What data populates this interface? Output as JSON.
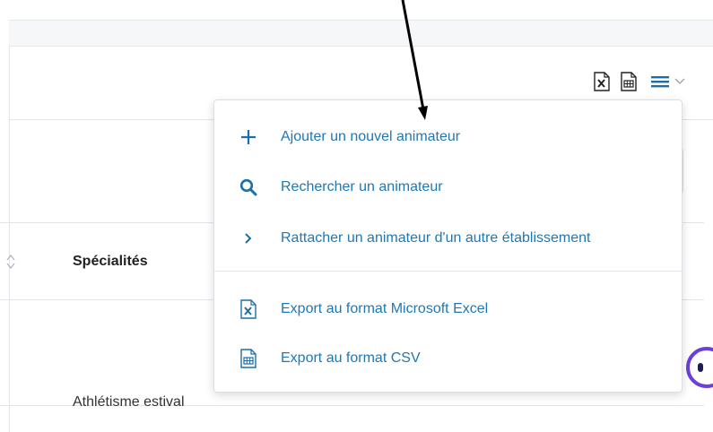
{
  "toolbar": {
    "export_excel_icon": "excel-file-icon",
    "export_csv_icon": "csv-file-icon",
    "menu_icon": "hamburger-menu-icon",
    "menu_caret_icon": "chevron-down-icon"
  },
  "table": {
    "columns": [
      {
        "label": "Spécialités"
      }
    ],
    "rows": [
      {
        "specialites": "Athlétisme estival"
      }
    ]
  },
  "dropdown": {
    "items": [
      {
        "icon": "plus-icon",
        "label": "Ajouter un nouvel animateur"
      },
      {
        "icon": "search-icon",
        "label": "Rechercher un animateur"
      },
      {
        "icon": "chevron-right-icon",
        "label": "Rattacher un animateur d'un autre établissement"
      },
      {
        "icon": "excel-file-icon",
        "label": "Export au format Microsoft Excel"
      },
      {
        "icon": "csv-file-icon",
        "label": "Export au format CSV"
      }
    ]
  },
  "colors": {
    "link_blue": "#1f78b4",
    "icon_blue": "#1c6fa8",
    "assistant_purple": "#6b3fd9",
    "border": "#e1e4e8"
  }
}
